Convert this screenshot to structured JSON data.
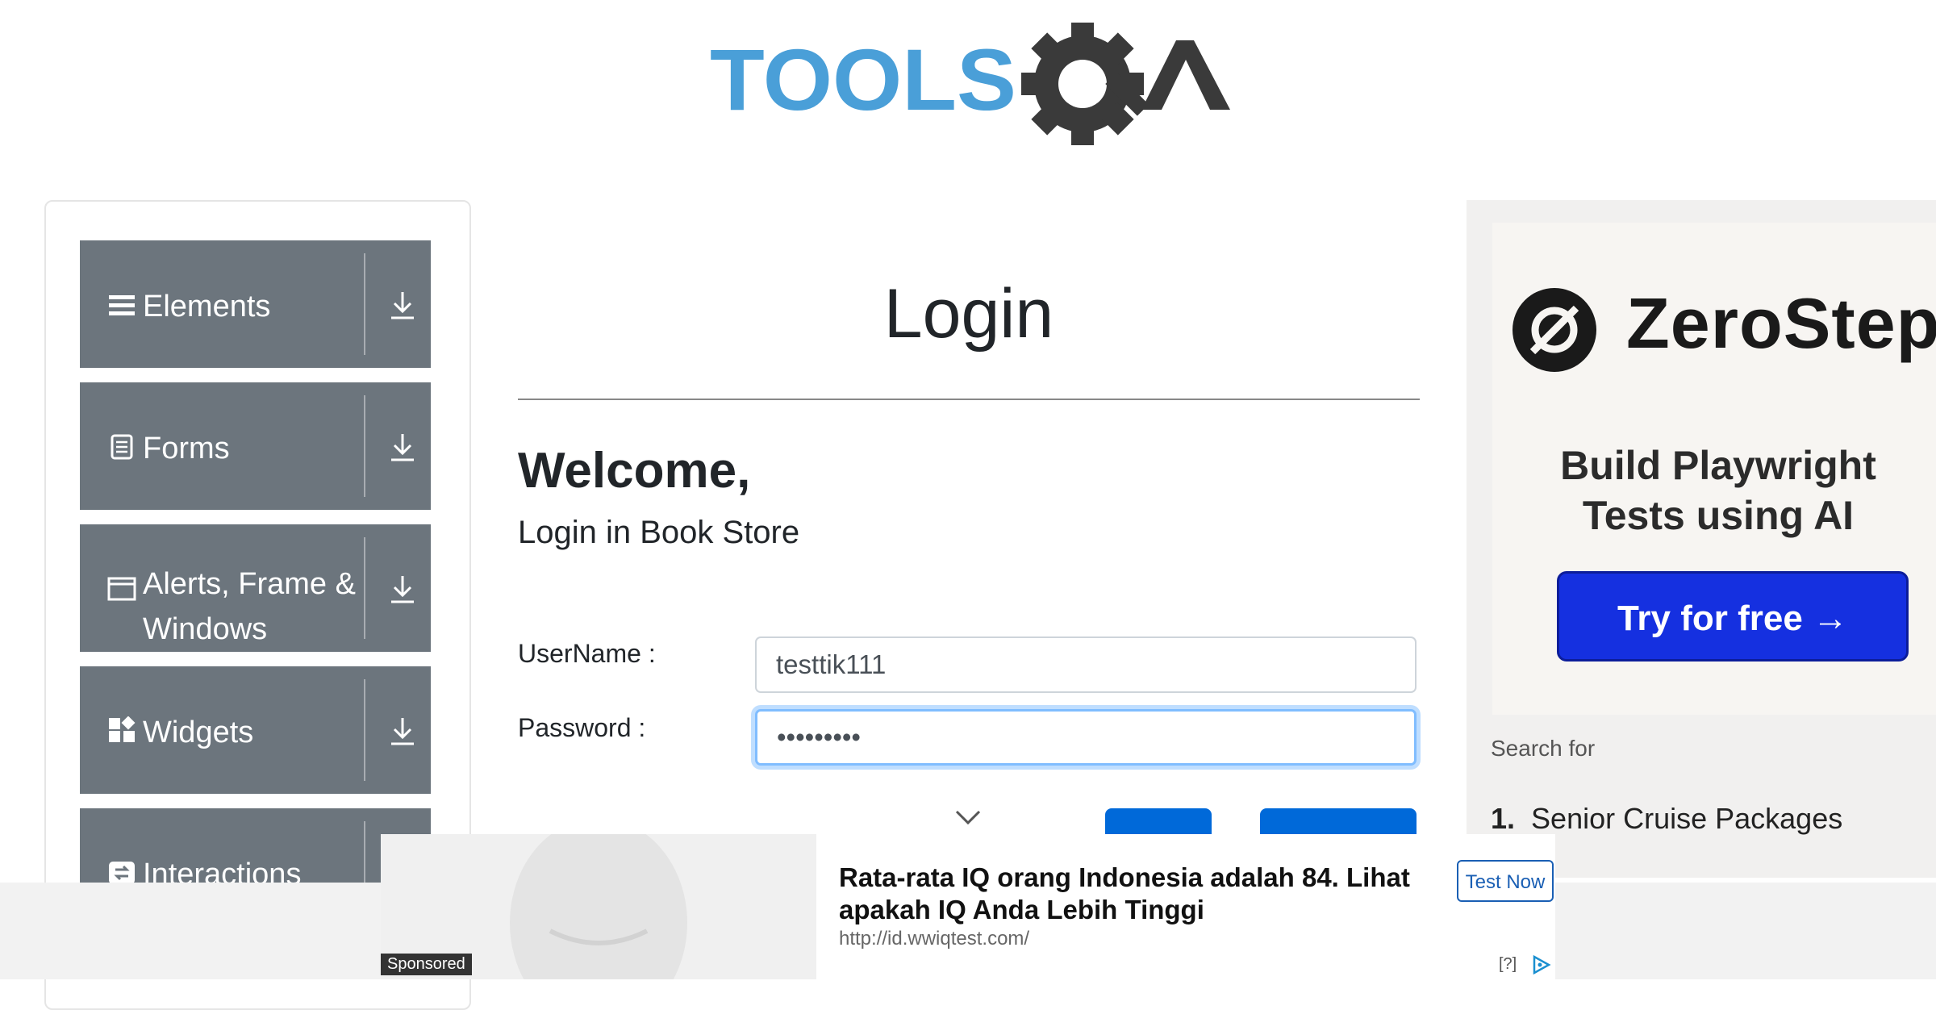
{
  "header": {
    "logo": "TOOLSQA"
  },
  "sidebar": {
    "items": [
      {
        "label": "Elements",
        "icon": "menu-lines-icon"
      },
      {
        "label": "Forms",
        "icon": "document-icon"
      },
      {
        "label": "Alerts, Frame & Windows",
        "icon": "window-icon"
      },
      {
        "label": "Widgets",
        "icon": "widgets-icon"
      },
      {
        "label": "Interactions",
        "icon": "interactions-icon"
      }
    ]
  },
  "main": {
    "title": "Login",
    "welcome": "Welcome,",
    "subtitle": "Login in Book Store",
    "username_label": "UserName :",
    "username_value": "testtik111",
    "password_label": "Password :",
    "password_value": "•••••••••"
  },
  "right_ad": {
    "brand": "ZeroStep",
    "tagline_line1": "Build Playwright",
    "tagline_line2": "Tests using AI",
    "cta": "Try for free →",
    "search_for": "Search for",
    "search_item_number": "1.",
    "search_item": "Senior Cruise Packages"
  },
  "bottom_ad": {
    "sponsored": "Sponsored",
    "headline": "Rata-rata IQ orang Indonesia adalah 84. Lihat apakah IQ Anda Lebih Tinggi",
    "url": "http://id.wwiqtest.com/",
    "cta": "Test Now",
    "help": "[?]"
  },
  "colors": {
    "nav_card": "#6c757d",
    "focus": "#80bdff",
    "brand_blue": "#4a9fd8",
    "cta_blue": "#1530e0"
  }
}
